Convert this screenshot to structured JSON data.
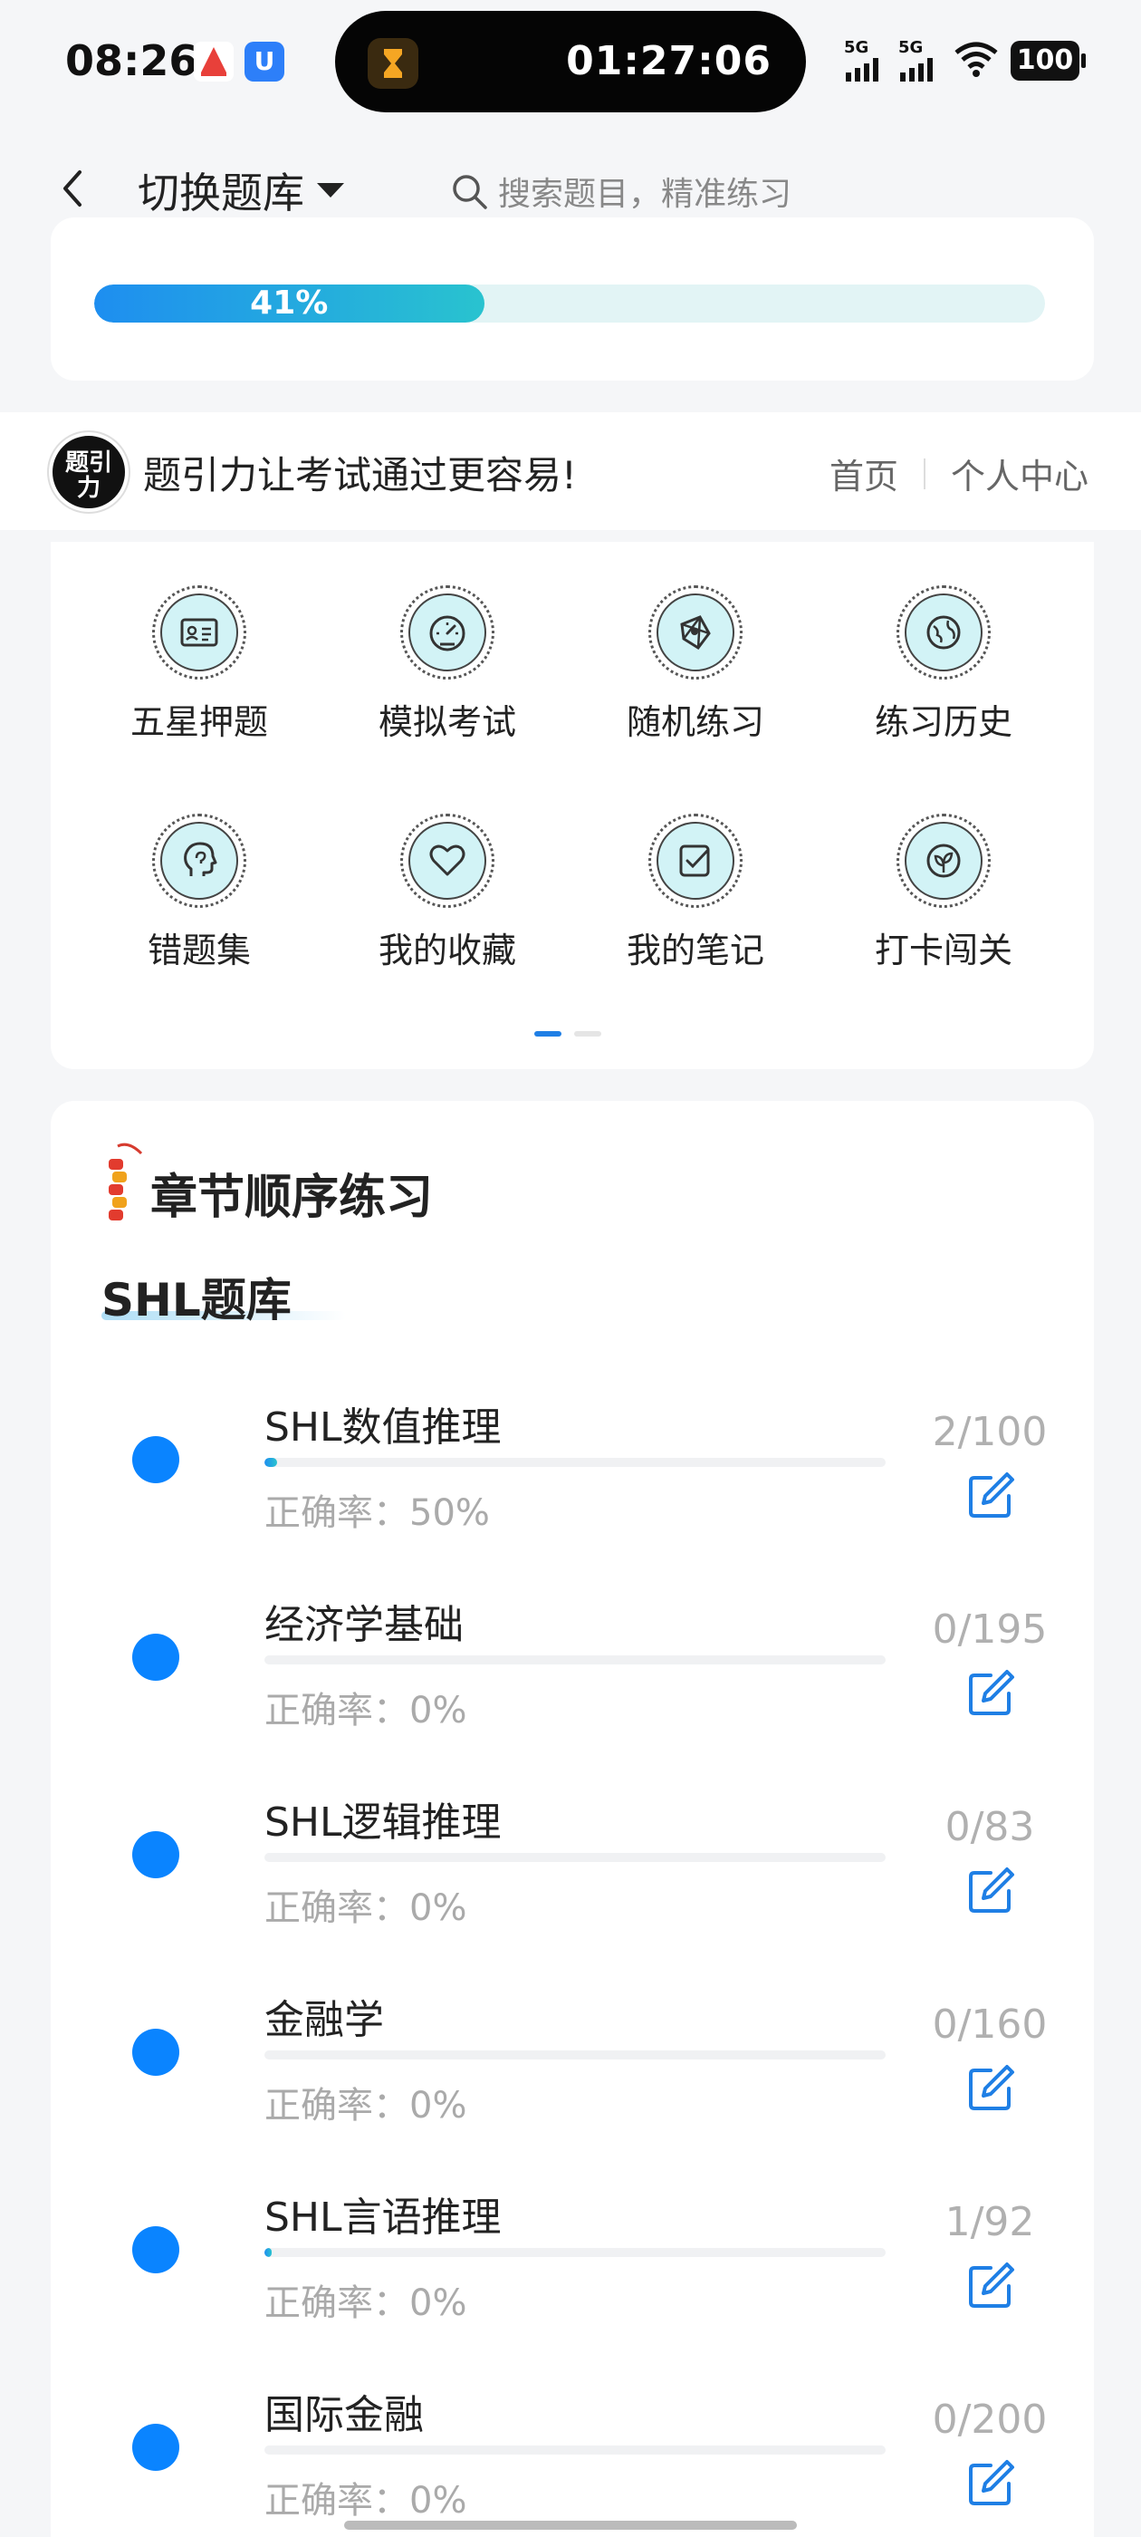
{
  "status_bar": {
    "time": "08:26",
    "timer": "01:27:06",
    "signal1": "5G",
    "signal2": "5G",
    "battery": "100",
    "app2_glyph": "U"
  },
  "header": {
    "switch_label": "切换题库",
    "search_placeholder": "搜索题目，精准练习"
  },
  "progress": {
    "percent_label": "41%",
    "fraction": 0.41
  },
  "brand": {
    "logo_text_line1": "题引",
    "logo_text_line2": "力",
    "slogan": "题引力让考试通过更容易!",
    "links": [
      "首页",
      "个人中心"
    ]
  },
  "grid": {
    "items": [
      {
        "label": "五星押题",
        "icon": "id-card-icon"
      },
      {
        "label": "模拟考试",
        "icon": "gauge-icon"
      },
      {
        "label": "随机练习",
        "icon": "network-icon"
      },
      {
        "label": "练习历史",
        "icon": "globe-icon"
      },
      {
        "label": "错题集",
        "icon": "head-icon"
      },
      {
        "label": "我的收藏",
        "icon": "heart-icon"
      },
      {
        "label": "我的笔记",
        "icon": "note-check-icon"
      },
      {
        "label": "打卡闯关",
        "icon": "leaf-icon"
      }
    ],
    "page_count": 2,
    "active_page": 0
  },
  "chapter": {
    "title": "章节顺序练习",
    "bank_name": "SHL题库",
    "items": [
      {
        "name": "SHL数值推理",
        "accuracy": "正确率：50%",
        "count": "2/100",
        "progress": 0.02
      },
      {
        "name": "经济学基础",
        "accuracy": "正确率：0%",
        "count": "0/195",
        "progress": 0
      },
      {
        "name": "SHL逻辑推理",
        "accuracy": "正确率：0%",
        "count": "0/83",
        "progress": 0
      },
      {
        "name": "金融学",
        "accuracy": "正确率：0%",
        "count": "0/160",
        "progress": 0
      },
      {
        "name": "SHL言语推理",
        "accuracy": "正确率：0%",
        "count": "1/92",
        "progress": 0.011
      },
      {
        "name": "国际金融",
        "accuracy": "正确率：0%",
        "count": "0/200",
        "progress": 0
      }
    ]
  },
  "colors": {
    "accent": "#0a84ff",
    "progress_start": "#1e8ef0",
    "progress_end": "#29c3cf",
    "icon_bg": "#d2f3f6"
  }
}
